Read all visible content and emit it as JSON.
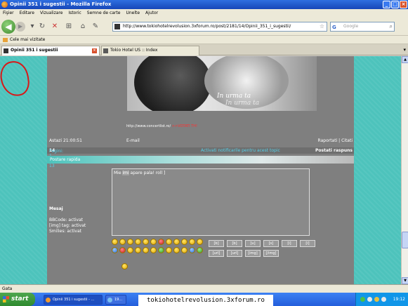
{
  "window": {
    "title": "Opinii 351 i sugestii - Mozilla Firefox",
    "controls": [
      "_",
      "□",
      "×"
    ]
  },
  "menu": [
    "Fişier",
    "Editare",
    "Vizualizare",
    "Istoric",
    "Semne de carte",
    "Unelte",
    "Ajutor"
  ],
  "nav": {
    "url": "http://www.tokiohotelrevolusion.3xforum.ro/post/2181/14/Opinii_351_i_sugestii/",
    "search_placeholder": "Google",
    "search_engine": "G"
  },
  "bookmarks": {
    "item": "Cele mai vizitate"
  },
  "tabs": [
    {
      "label": "Opinii 351 i sugestii",
      "active": true
    },
    {
      "label": "Tokio Hotel US :: Index",
      "active": false
    }
  ],
  "banner": {
    "line1": "In urma ta",
    "line2": "In urma ta"
  },
  "page": {
    "link_line": "http://www.concertlist.ro/",
    "vote_text": ">>VOTATI TH!",
    "time": "Astazi 21:00:51",
    "email": "E-mail",
    "report": "Raportati | Citati",
    "pagination": "Pagini: 1 ... 11 12 13",
    "current_page": "14",
    "notify": "Activati notificarile pentru acest topic",
    "reply": "Postati raspuns",
    "quick_post": "Postare rapida",
    "message_label": "Mesaj",
    "bbcode_status": "BBCode: activat",
    "img_status": "[img] tag: activat",
    "smilies_status": "Smilies: activat",
    "textarea_text_pre": "Mie ",
    "textarea_text_hl": "imi",
    "textarea_text_post": " apare pala! roll ]"
  },
  "bbcodes": {
    "row1": [
      "[b]",
      "[b]",
      "[u]",
      "[s]",
      "[i]",
      "[i]"
    ],
    "row2": [
      "[url]",
      "[url]",
      "[img]",
      "[/img]"
    ]
  },
  "status": {
    "text": "Gata"
  },
  "taskbar": {
    "start": "start",
    "tasks": [
      "Opinii 351 i sugestii - ...",
      "19..."
    ],
    "clock": "19:12"
  },
  "overlay": {
    "text": "tokiohotelrevolusion.3xforum.ro"
  }
}
